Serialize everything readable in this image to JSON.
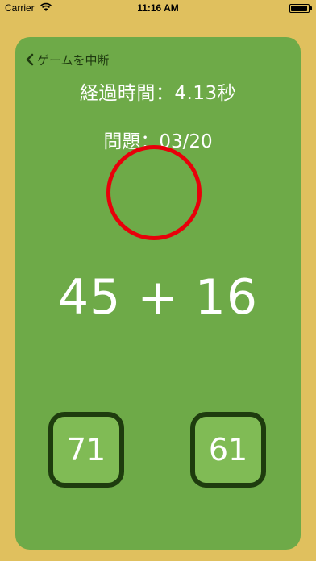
{
  "status_bar": {
    "carrier": "Carrier",
    "time": "11:16 AM",
    "icons": [
      "wifi-icon",
      "battery-icon"
    ]
  },
  "game": {
    "back_label": "ゲームを中断",
    "elapsed_text": "経過時間：4.13秒",
    "question_text": "問題：03/20",
    "problem": "45 + 16",
    "answers": [
      "71",
      "61"
    ],
    "feedback": "incorrect"
  },
  "colors": {
    "background": "#e0c05e",
    "card": "#6eaa48",
    "button_fill": "#80bb55",
    "button_border": "#1e3c0e",
    "feedback_ring": "#e8000a"
  }
}
